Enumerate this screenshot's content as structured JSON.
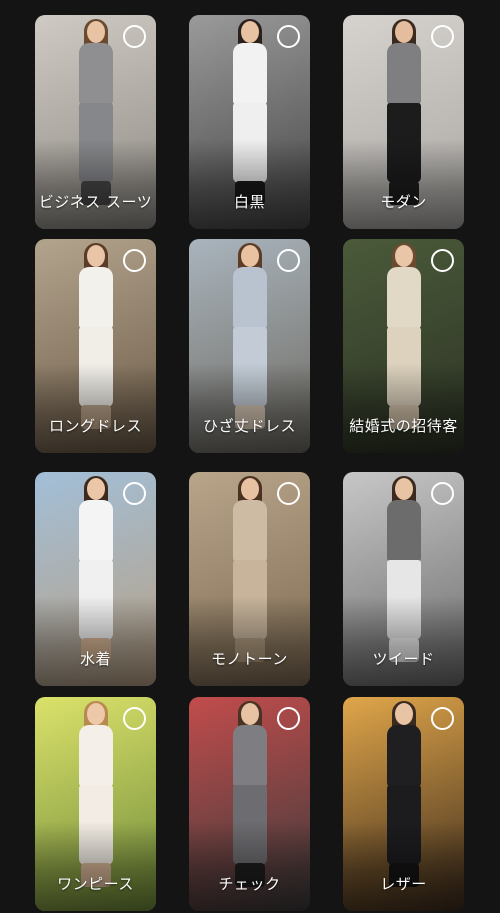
{
  "styles": [
    {
      "label": "ビジネス スーツ",
      "radio_icon": "radio-unchecked-icon",
      "colors": {
        "bg": "#cfcac3",
        "bg2": "#8e8a84",
        "skin": "#e8c3a4",
        "hair": "#6b4a2f",
        "top": "#8f8f91",
        "bottom": "#86878a",
        "feet": "#4a4a4a"
      }
    },
    {
      "label": "白黒",
      "radio_icon": "radio-unchecked-icon",
      "colors": {
        "bg": "#9a9a9a",
        "bg2": "#454545",
        "skin": "#e7c2a3",
        "hair": "#2b211c",
        "top": "#f2f2f2",
        "bottom": "#efefef",
        "feet": "#1a1a1a"
      }
    },
    {
      "label": "モダン",
      "radio_icon": "radio-unchecked-icon",
      "colors": {
        "bg": "#d6d3cf",
        "bg2": "#a9a6a2",
        "skin": "#e3bd9d",
        "hair": "#3a2a20",
        "top": "#7f7f82",
        "bottom": "#1c1c1c",
        "feet": "#1e1e1e"
      }
    },
    {
      "label": "ロングドレス",
      "radio_icon": "radio-unchecked-icon",
      "colors": {
        "bg": "#b3a48e",
        "bg2": "#6c5b47",
        "skin": "#e9c4a6",
        "hair": "#5a3c27",
        "top": "#f3f1ec",
        "bottom": "#f1eee8",
        "feet": "#bfa68c"
      }
    },
    {
      "label": "ひざ丈ドレス",
      "radio_icon": "radio-unchecked-icon",
      "colors": {
        "bg": "#a9b4bd",
        "bg2": "#6e6a61",
        "skin": "#e8c2a1",
        "hair": "#5b3d28",
        "top": "#b8c3cf",
        "bottom": "#c3ccd6",
        "feet": "#d9c9b6"
      }
    },
    {
      "label": "結婚式の招待客",
      "radio_icon": "radio-unchecked-icon",
      "colors": {
        "bg": "#4b5a3a",
        "bg2": "#2c3324",
        "skin": "#e9c6a8",
        "hair": "#6b4a30",
        "top": "#e2d8c6",
        "bottom": "#ddd2be",
        "feet": "#d8c6ad"
      }
    },
    {
      "label": "水着",
      "radio_icon": "radio-unchecked-icon",
      "colors": {
        "bg": "#a2bfd8",
        "bg2": "#b79f83",
        "skin": "#ebc7a8",
        "hair": "#3d2a1e",
        "top": "#f4f4f4",
        "bottom": "#f0f0f0",
        "feet": "#d9b898"
      }
    },
    {
      "label": "モノトーン",
      "radio_icon": "radio-unchecked-icon",
      "colors": {
        "bg": "#b8a58a",
        "bg2": "#7d6a52",
        "skin": "#e7c2a2",
        "hair": "#4a3122",
        "top": "#cdbba3",
        "bottom": "#c7b49b",
        "feet": "#b29c80"
      }
    },
    {
      "label": "ツイード",
      "radio_icon": "radio-unchecked-icon",
      "colors": {
        "bg": "#c7c7c7",
        "bg2": "#6b6b6b",
        "skin": "#e9c4a4",
        "hair": "#3a2a20",
        "top": "#6c6c6c",
        "bottom": "#e6e6e6",
        "feet": "#f2f2f2"
      }
    },
    {
      "label": "ワンピース",
      "radio_icon": "radio-unchecked-icon",
      "colors": {
        "bg": "#dbe26a",
        "bg2": "#6f8a3a",
        "skin": "#edc8a9",
        "hair": "#b88a4f",
        "top": "#f4efe8",
        "bottom": "#f2ece4",
        "feet": "#d9b898"
      }
    },
    {
      "label": "チェック",
      "radio_icon": "radio-unchecked-icon",
      "colors": {
        "bg": "#c24c4c",
        "bg2": "#3a3a3a",
        "skin": "#e8c3a3",
        "hair": "#4a3324",
        "top": "#7e7e82",
        "bottom": "#6d6d71",
        "feet": "#1f1f1f"
      }
    },
    {
      "label": "レザー",
      "radio_icon": "radio-unchecked-icon",
      "colors": {
        "bg": "#e0a64a",
        "bg2": "#3b2a1c",
        "skin": "#e9c4a4",
        "hair": "#3a2a20",
        "top": "#1f1f22",
        "bottom": "#1c1c1f",
        "feet": "#151515"
      }
    }
  ]
}
